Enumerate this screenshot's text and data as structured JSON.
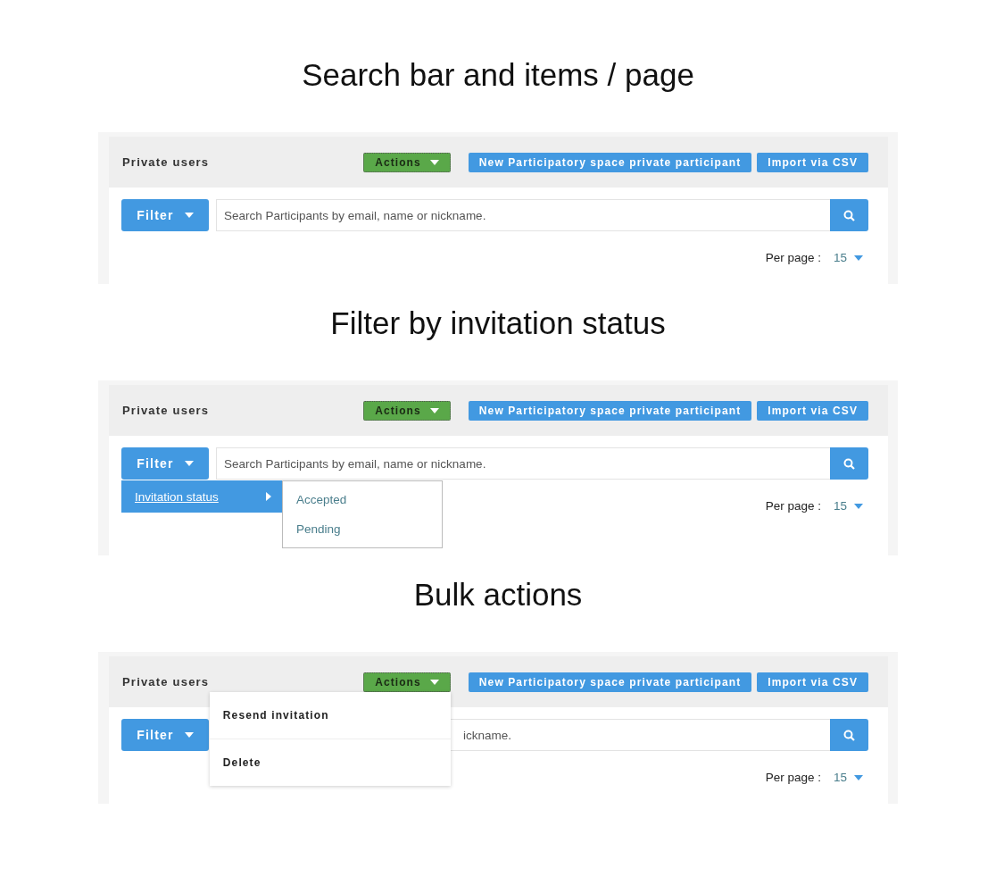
{
  "sections": [
    {
      "heading": "Search bar and items / page",
      "panel": {
        "title": "Private users",
        "actions": {
          "label": "Actions"
        },
        "buttons": [
          "New Participatory space private participant",
          "Import via CSV"
        ],
        "filter": {
          "label": "Filter"
        },
        "search": {
          "placeholder": "Search Participants by email, name or nickname."
        },
        "per_page": {
          "label": "Per page :",
          "value": "15"
        }
      }
    },
    {
      "heading": "Filter by invitation status",
      "panel": {
        "title": "Private users",
        "actions": {
          "label": "Actions"
        },
        "buttons": [
          "New Participatory space private participant",
          "Import via CSV"
        ],
        "filter": {
          "label": "Filter",
          "menu": [
            {
              "label": "Invitation status",
              "expanded": true,
              "children": [
                {
                  "label": "Accepted"
                },
                {
                  "label": "Pending"
                }
              ]
            }
          ]
        },
        "search": {
          "placeholder": "Search Participants by email, name or nickname."
        },
        "per_page": {
          "label": "Per page :",
          "value": "15"
        }
      }
    },
    {
      "heading": "Bulk actions",
      "panel": {
        "title": "Private users",
        "actions": {
          "label": "Actions",
          "menu": [
            "Resend invitation",
            "Delete"
          ]
        },
        "buttons": [
          "New Participatory space private participant",
          "Import via CSV"
        ],
        "filter": {
          "label": "Filter"
        },
        "search": {
          "placeholder": "ickname."
        },
        "per_page": {
          "label": "Per page :",
          "value": "15"
        }
      }
    }
  ]
}
